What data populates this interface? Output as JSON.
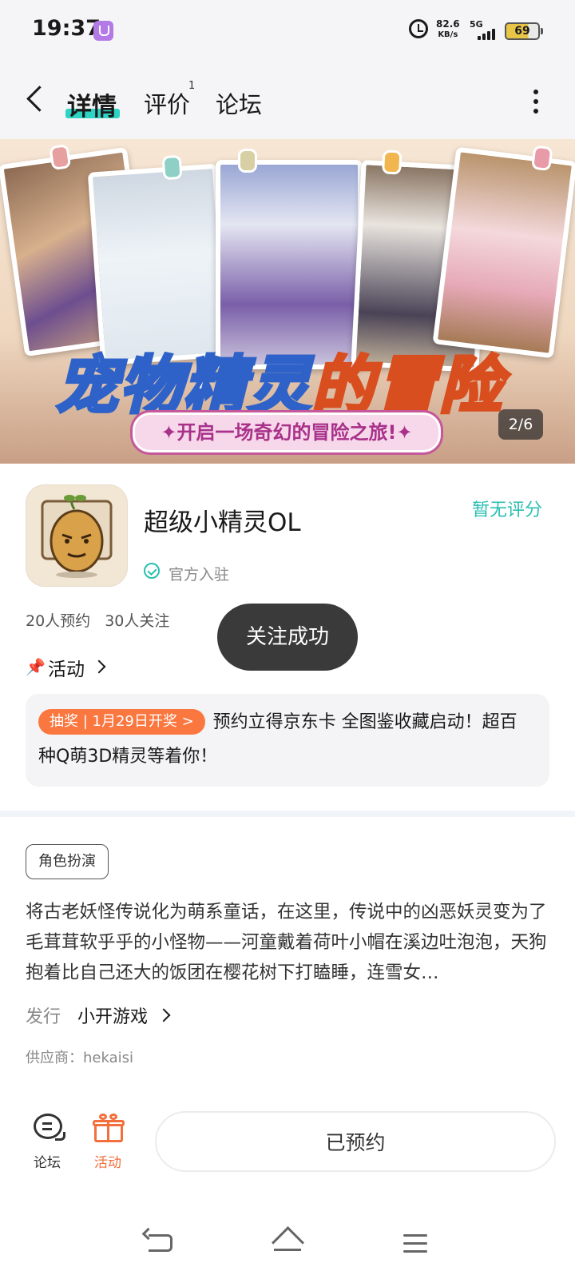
{
  "status_bar": {
    "time": "19:37",
    "net_speed_value": "82.6",
    "net_speed_unit": "KB/s",
    "network_type": "5G",
    "battery_level": "69"
  },
  "nav": {
    "tabs": [
      {
        "label": "详情",
        "active": true
      },
      {
        "label": "评价",
        "badge": "1"
      },
      {
        "label": "论坛"
      }
    ]
  },
  "banner": {
    "title_part1": "宠物精灵",
    "title_part2": "的冒险",
    "subtitle": "✦开启一场奇幻的冒险之旅!✦",
    "counter": "2/6"
  },
  "game": {
    "name": "超级小精灵OL",
    "score": "暂无评分",
    "verified": "官方入驻",
    "reservations": "20人预约",
    "followers": "30人关注"
  },
  "toast": "关注成功",
  "activity": {
    "header": "活动",
    "tag": "抽奖 | 1月29日开奖 >",
    "text": "预约立得京东卡 全图鉴收藏启动！超百种Q萌3D精灵等着你！"
  },
  "details": {
    "genre": "角色扮演",
    "description": "将古老妖怪传说化为萌系童话，在这里，传说中的凶恶妖灵变为了毛茸茸软乎乎的小怪物——河童戴着荷叶小帽在溪边吐泡泡，天狗抱着比自己还大的饭团在樱花树下打瞌睡，连雪女…",
    "publisher_label": "发行",
    "publisher": "小开游戏",
    "supplier": "供应商：hekaisi"
  },
  "bottom_bar": {
    "forum_label": "论坛",
    "activity_label": "活动",
    "reserved_button": "已预约"
  },
  "colors": {
    "accent_teal": "#2bbfb1",
    "accent_orange": "#fb7740"
  }
}
